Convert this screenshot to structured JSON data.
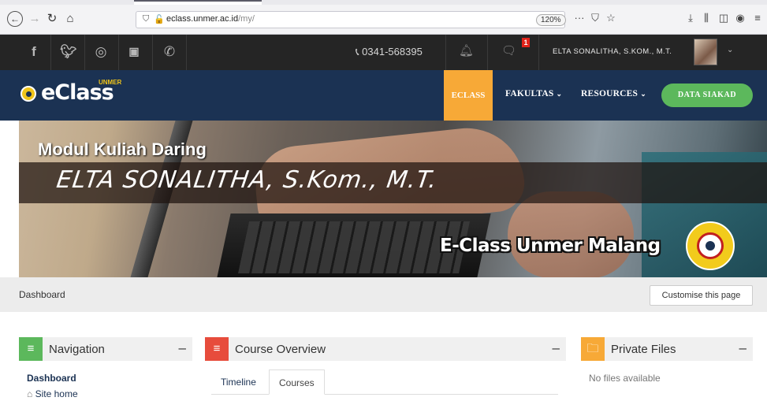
{
  "browser": {
    "url_host": "eclass.unmer.ac.id",
    "url_path": "/my/",
    "zoom": "120%",
    "back_icon": "back-arrow-icon",
    "forward_icon": "forward-arrow-icon",
    "reload_icon": "reload-icon",
    "home_icon": "home-icon"
  },
  "topbar": {
    "phone": "0341-568395",
    "notification_count": "1",
    "user_name": "ELTA SONALITHA, S.KOM., M.T."
  },
  "header": {
    "logo_text": "eClass",
    "logo_sup": "UNMER",
    "menu": {
      "eclass": "ECLASS",
      "fakultas": "FAKULTAS",
      "resources": "RESOURCES"
    },
    "data_button": "DATA SIAKAD",
    "colors": {
      "navy": "#1b3253",
      "orange": "#f7a937",
      "green": "#5cb85c"
    }
  },
  "banner": {
    "title": "Modul Kuliah Daring",
    "name": "ELTA SONALITHA, S.Kom., M.T.",
    "subtitle": "E-Class Unmer Malang"
  },
  "breadcrumb": {
    "label": "Dashboard",
    "customise_button": "Customise this page"
  },
  "blocks": {
    "navigation": {
      "title": "Navigation",
      "items": [
        "Dashboard",
        "Site home"
      ],
      "color": "#5cb85c"
    },
    "course_overview": {
      "title": "Course Overview",
      "tabs": [
        "Timeline",
        "Courses"
      ],
      "active_tab": "Courses",
      "color": "#e74c3c"
    },
    "private_files": {
      "title": "Private Files",
      "empty_text": "No files available",
      "color": "#f7a937"
    }
  }
}
